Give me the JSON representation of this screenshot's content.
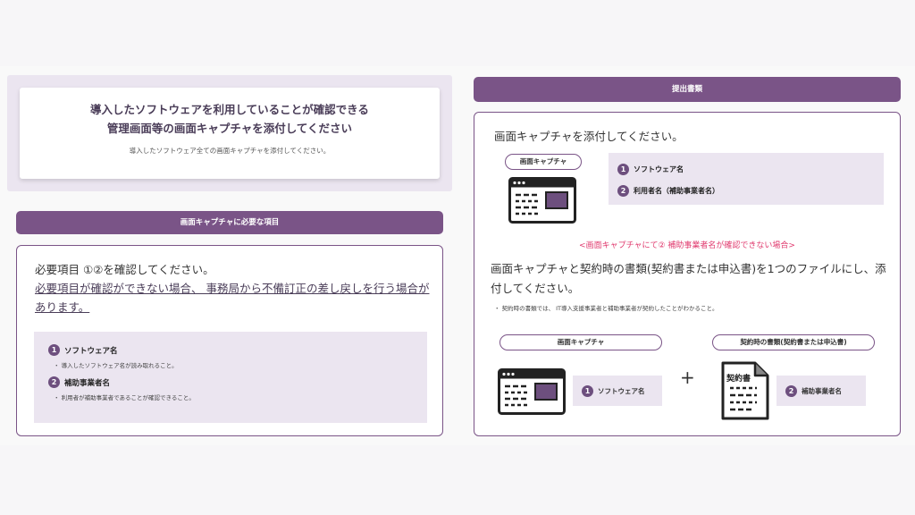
{
  "intro": {
    "title_line1": "導入したソフトウェアを利用していることが確認できる",
    "title_line2": "管理画面等の画面キャプチャを添付してください",
    "subtitle": "導入したソフトウェア全ての画面キャプチャを添付してください。"
  },
  "left_section": {
    "header": "画面キャプチャに必要な項目",
    "required_text": "必要項目 ①②を確認してください。",
    "warning_text": "必要項目が確認ができない場合、 事務局から不備訂正の差し戻しを行う場合があります。",
    "items": [
      {
        "num": "1",
        "label": "ソフトウェア名",
        "note": "・ 導入したソフトウェア名が読み取れること。"
      },
      {
        "num": "2",
        "label": "補助事業者名",
        "note": "・ 利用者が補助事業者であることが確認できること。"
      }
    ]
  },
  "right_section": {
    "header": "提出書類",
    "heading": "画面キャプチャを添付してください。",
    "pill_capture": "画面キャプチャ",
    "items": [
      {
        "num": "1",
        "label": "ソフトウェア名"
      },
      {
        "num": "2",
        "label": "利用者名（補助事業者名）"
      }
    ],
    "warning": "<画面キャプチャにて② 補助事業者名が確認できない場合>",
    "body": "画面キャプチャと契約時の書類(契約書または申込書)を1つのファイルにし、添付してください。",
    "note": "・ 契約時の書類では、 IT導入支援事業者と補助事業者が契約したことがわかること。",
    "pill_capture2": "画面キャプチャ",
    "pill_contract": "契約時の書類(契約書または申込書)",
    "plus": "+",
    "contract_icon_label": "契約書",
    "bottom_items": [
      {
        "num": "1",
        "label": "ソフトウェア名"
      },
      {
        "num": "2",
        "label": "補助事業者名"
      }
    ]
  },
  "colors": {
    "accent": "#7a5487",
    "lavender": "#ebe5f0",
    "warning": "#e03a6e",
    "title": "#4a3d58"
  }
}
